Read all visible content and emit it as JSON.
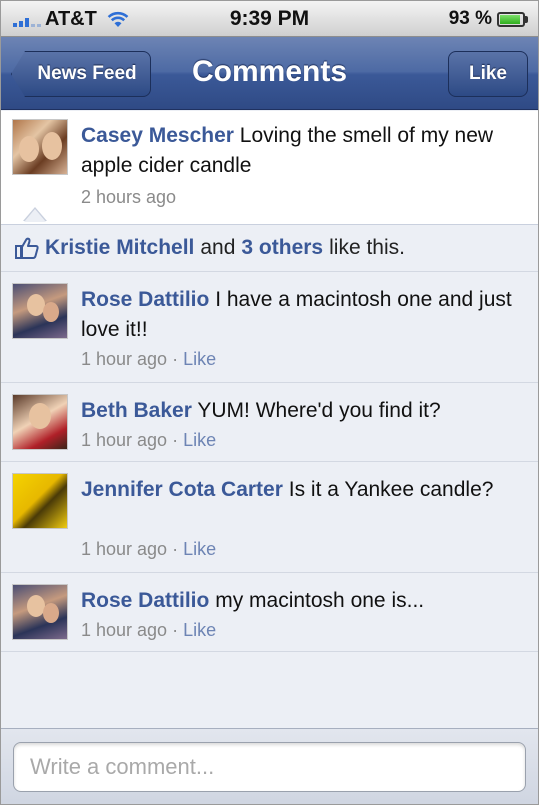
{
  "status_bar": {
    "carrier": "AT&T",
    "time": "9:39 PM",
    "battery_percent": "93 %"
  },
  "nav": {
    "back_label": "News Feed",
    "title": "Comments",
    "like_label": "Like"
  },
  "post": {
    "author": "Casey Mescher",
    "text": "Loving the smell of my new apple cider candle",
    "time": "2 hours ago"
  },
  "likes": {
    "first_name": "Kristie Mitchell",
    "and": "and",
    "others": "3 others",
    "suffix": "like this."
  },
  "comments": [
    {
      "author": "Rose Dattilio",
      "text": "I have a macintosh one and just love it!!",
      "time": "1 hour ago",
      "separator": "·",
      "like": "Like"
    },
    {
      "author": "Beth Baker",
      "text": "YUM! Where'd you find it?",
      "time": "1 hour ago",
      "separator": "·",
      "like": "Like"
    },
    {
      "author": "Jennifer Cota Carter",
      "text": "Is it a Yankee candle?",
      "time": "1 hour ago",
      "separator": "·",
      "like": "Like"
    },
    {
      "author": "Rose Dattilio",
      "text": "my macintosh one is...",
      "time": "1 hour ago",
      "separator": "·",
      "like": "Like"
    }
  ],
  "composer": {
    "placeholder": "Write a comment..."
  },
  "colors": {
    "brand": "#3b5998",
    "link": "#6d84b4",
    "meta": "#8a8a8a",
    "background": "#eceff5"
  },
  "icons": [
    "signal-bars-icon",
    "wifi-icon",
    "battery-icon",
    "thumbs-up-icon"
  ]
}
